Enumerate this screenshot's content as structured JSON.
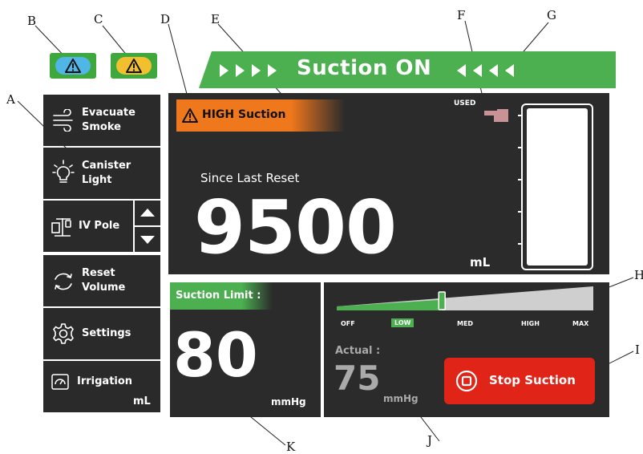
{
  "callouts": {
    "A": "A",
    "B": "B",
    "C": "C",
    "D": "D",
    "E": "E",
    "F": "F",
    "G": "G",
    "H": "H",
    "I": "I",
    "J": "J",
    "K": "K"
  },
  "banner": {
    "title": "Suction ON"
  },
  "sidebar": {
    "evacuate": {
      "line1": "Evacuate",
      "line2": "Smoke"
    },
    "canister": {
      "line1": "Canister",
      "line2": "Light"
    },
    "iv_pole": {
      "label": "IV Pole"
    },
    "reset": {
      "line1": "Reset",
      "line2": "Volume"
    },
    "settings": {
      "label": "Settings"
    },
    "irrigation": {
      "label": "Irrigation",
      "unit": "mL"
    }
  },
  "volume": {
    "alert": "HIGH Suction",
    "since_label": "Since Last Reset",
    "value": "9500",
    "unit": "mL",
    "used_label": "USED"
  },
  "limit": {
    "label": "Suction Limit :",
    "value": "80",
    "unit": "mmHg"
  },
  "level": {
    "ticks": [
      "OFF",
      "LOW",
      "MED",
      "HIGH",
      "MAX"
    ],
    "position_fraction": 0.41,
    "actual_label": "Actual :",
    "actual_value": "75",
    "actual_unit": "mmHg"
  },
  "stop": {
    "label": "Stop Suction"
  },
  "colors": {
    "green": "#4caf50",
    "orange": "#f0781c",
    "red": "#e02518",
    "panel": "#2b2b2b"
  }
}
